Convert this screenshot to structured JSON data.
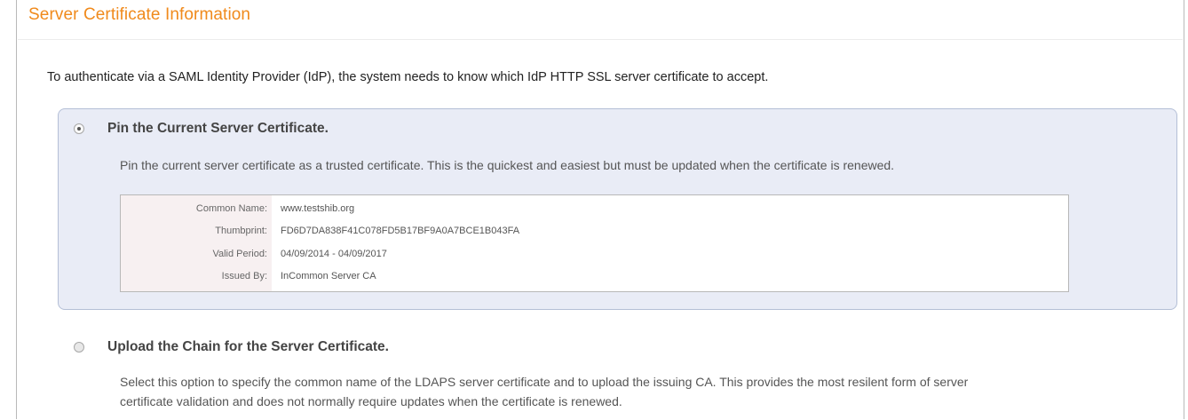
{
  "header": {
    "title": "Server Certificate Information"
  },
  "intro_text": "To authenticate via a SAML Identity Provider (IdP), the system needs to know which IdP HTTP SSL server certificate to accept.",
  "options": [
    {
      "title": "Pin the Current Server Certificate.",
      "description": "Pin the current server certificate as a trusted certificate. This is the quickest and easiest but must be updated when the certificate is renewed.",
      "selected": true
    },
    {
      "title": "Upload the Chain for the Server Certificate.",
      "description_line1": "Select this option to specify the common name of the LDAPS server certificate and to upload the issuing CA. This provides the most resilent form of server",
      "description_line2": "certificate validation and does not normally require updates when the certificate is renewed.",
      "selected": false
    }
  ],
  "certificate": {
    "rows": [
      {
        "label": "Common Name:",
        "value": "www.testshib.org"
      },
      {
        "label": "Thumbprint:",
        "value": "FD6D7DA838F41C078FD5B17BF9A0A7BCE1B043FA"
      },
      {
        "label": "Valid Period:",
        "value": "04/09/2014 - 04/09/2017"
      },
      {
        "label": "Issued By:",
        "value": "InCommon Server CA"
      }
    ]
  },
  "colors": {
    "title": "#f08a1c",
    "option_panel_bg": "#e9ecf6",
    "option_panel_border": "#b4bfd6"
  }
}
